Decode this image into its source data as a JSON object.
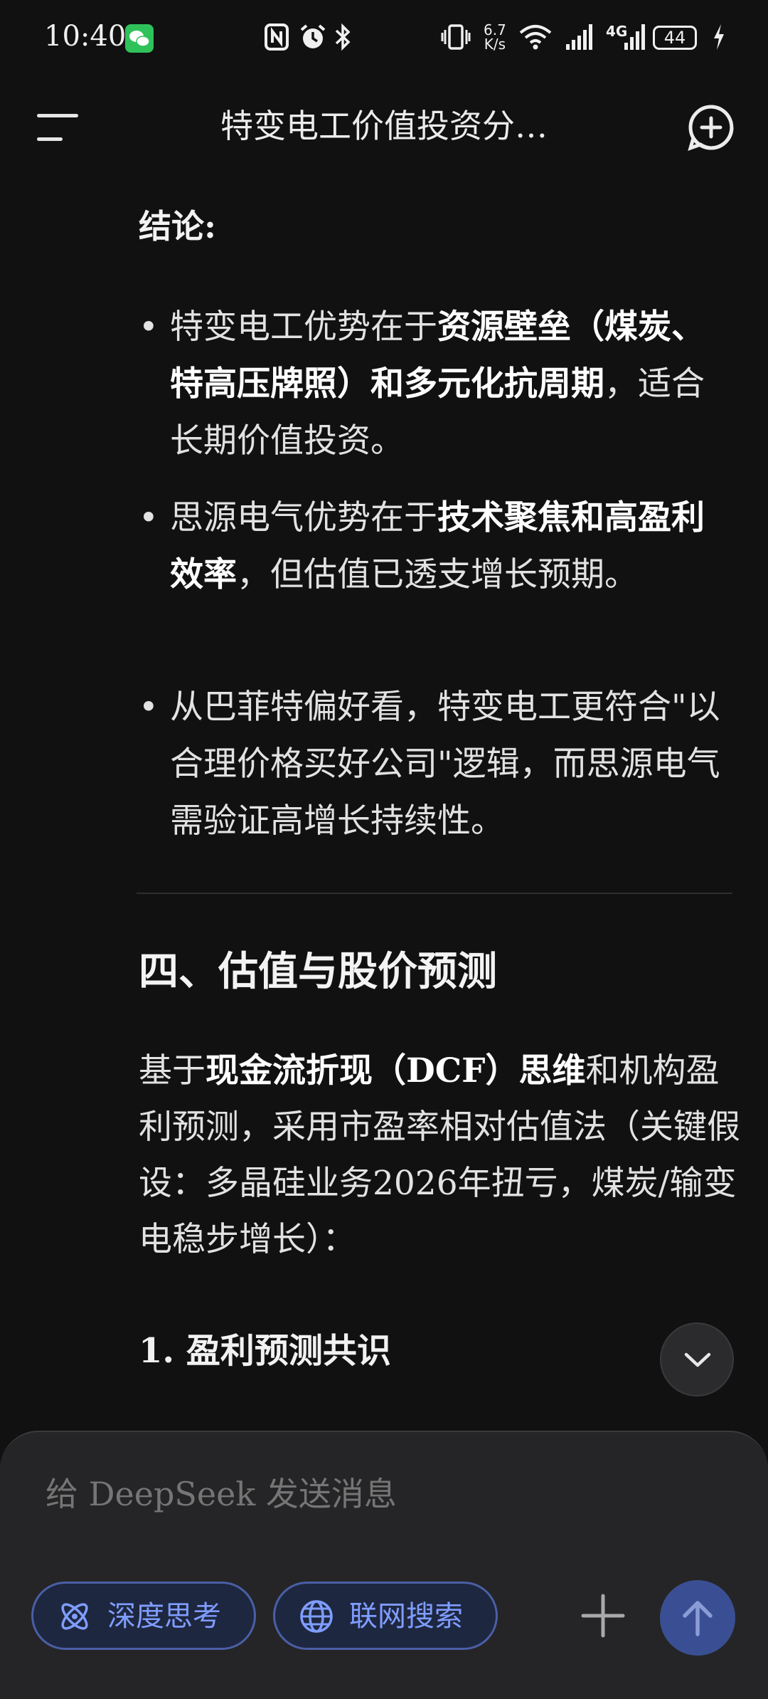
{
  "status_bar": {
    "time": "10:40",
    "net_speed_value": "6.7",
    "net_speed_unit": "K/s",
    "network": "4G",
    "battery": "44"
  },
  "header": {
    "title": "特变电工价值投资分…"
  },
  "content": {
    "conclusion_title": "结论:",
    "bullets": [
      {
        "pre": "特变电工优势在于",
        "bold": "资源壁垒（煤炭、特高压牌照）和多元化抗周期",
        "post": "，适合长期价值投资。"
      },
      {
        "pre": "思源电气优势在于",
        "bold": "技术聚焦和高盈利效率",
        "post": "，但估值已透支增长预期。"
      },
      {
        "pre": "从巴菲特偏好看，特变电工更符合\"以合理价格买好公司\"逻辑，而思源电气需验证高增长持续性。",
        "bold": "",
        "post": ""
      }
    ],
    "section_title": "四、估值与股价预测",
    "paragraph": {
      "pre": "基于",
      "bold": "现金流折现（DCF）思维",
      "post": "和机构盈利预测，采用市盈率相对估值法（关键假设：多晶硅业务2026年扭亏，煤炭/输变电稳步增长）："
    },
    "sub_title": "1. 盈利预测共识"
  },
  "composer": {
    "placeholder": "给 DeepSeek 发送消息",
    "deep_think_label": "深度思考",
    "web_search_label": "联网搜索"
  },
  "colors": {
    "background": "#111112",
    "accent": "#7f9dff",
    "send_button": "#3a4f93"
  },
  "icons": [
    "wechat-icon",
    "nfc-icon",
    "alarm-icon",
    "bluetooth-icon",
    "vibrate-icon",
    "wifi-icon",
    "signal-icon",
    "charging-icon",
    "menu-icon",
    "new-chat-icon",
    "chevron-down-icon",
    "atom-icon",
    "globe-icon",
    "plus-icon",
    "arrow-up-icon"
  ]
}
